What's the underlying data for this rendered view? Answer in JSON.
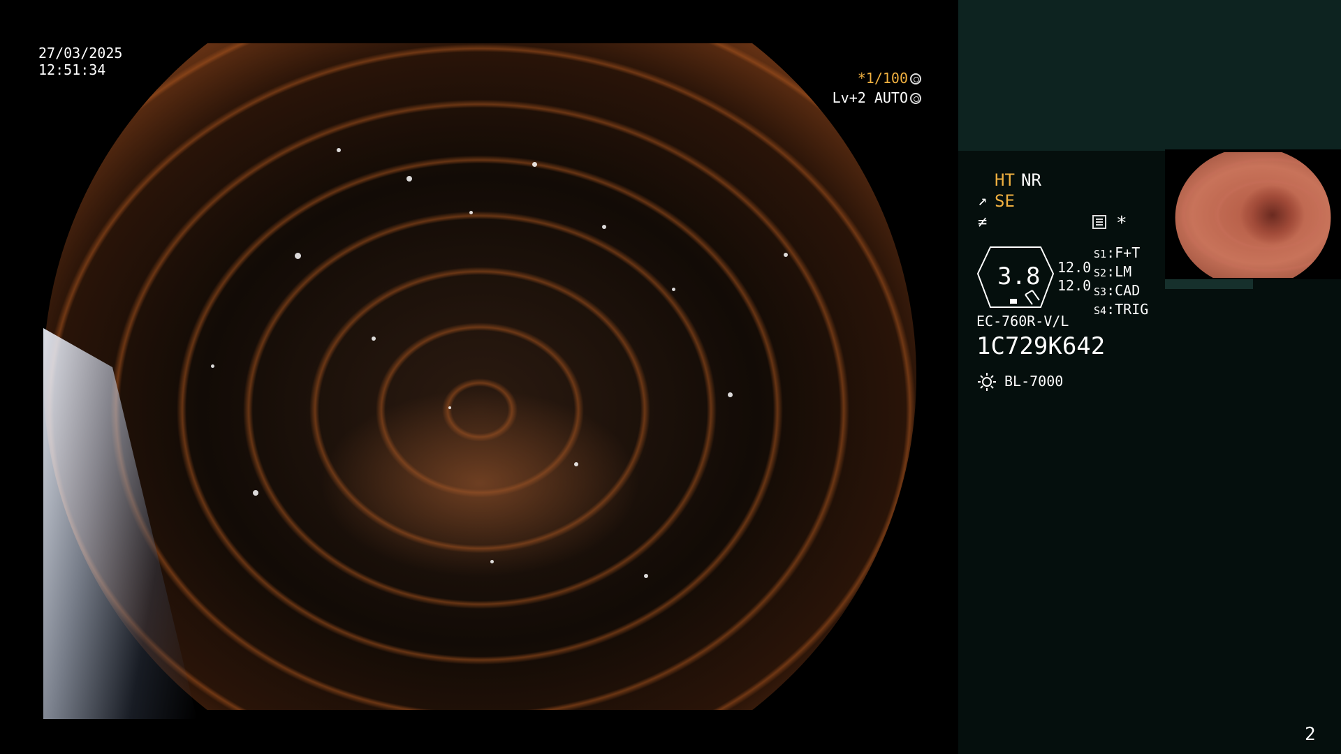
{
  "main": {
    "date": "27/03/2025",
    "time": "12:51:34",
    "exposure_prefix": "*",
    "exposure": "1/100",
    "level": "Lv+2",
    "mode": "AUTO",
    "icons": [
      "aperture-icon",
      "iris-icon"
    ]
  },
  "panel": {
    "ht": "HT",
    "nr": "NR",
    "se": "SE",
    "se_icon": "↗",
    "f_icon": "≠",
    "asterisk": "*",
    "octagon_value": "3.8",
    "values": [
      "12.0",
      "12.0"
    ],
    "slots": [
      {
        "label": "S1",
        "value": "F+T"
      },
      {
        "label": "S2",
        "value": "LM"
      },
      {
        "label": "S3",
        "value": "CAD"
      },
      {
        "label": "S4",
        "value": "TRIG"
      }
    ],
    "model": "EC-760R-V/L",
    "serial": "1C729K642",
    "light_source": "BL-7000",
    "page_number": "2"
  },
  "colors": {
    "accent_yellow": "#f0b040",
    "panel_bg": "#050f0d",
    "panel_top": "#0d2320"
  }
}
